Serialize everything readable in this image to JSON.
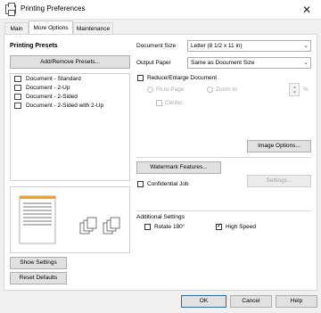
{
  "window": {
    "title": "Printing Preferences",
    "close_icon": "close-icon"
  },
  "tabs": [
    {
      "label": "Main",
      "active": false
    },
    {
      "label": "More Options",
      "active": true
    },
    {
      "label": "Maintenance",
      "active": false
    }
  ],
  "presets": {
    "title": "Printing Presets",
    "add_remove_label": "Add/Remove Presets...",
    "items": [
      {
        "label": "Document - Standard",
        "icon": "document-icon"
      },
      {
        "label": "Document - 2-Up",
        "icon": "two-up-icon"
      },
      {
        "label": "Document - 2-Sided",
        "icon": "two-sided-icon"
      },
      {
        "label": "Document - 2-Sided with 2-Up",
        "icon": "two-sided-two-up-icon"
      }
    ]
  },
  "left_buttons": {
    "show_settings": "Show Settings",
    "reset_defaults": "Reset Defaults"
  },
  "document_size": {
    "label": "Document Size",
    "value": "Letter (8 1/2 x 11 in)"
  },
  "output_paper": {
    "label": "Output Paper",
    "value": "Same as Document Size"
  },
  "reduce_enlarge": {
    "label": "Reduce/Enlarge Document",
    "fit_to_page": "Fit to Page",
    "zoom_to": "Zoom to",
    "percent": "%",
    "center": "Center"
  },
  "image_options_label": "Image Options...",
  "watermark_label": "Watermark Features...",
  "confidential_label": "Confidential Job",
  "settings_label": "Settings...",
  "additional": {
    "title": "Additional Settings",
    "rotate_label": "Rotate 180°",
    "rotate_checked": false,
    "high_speed_label": "High Speed",
    "high_speed_checked": true
  },
  "footer": {
    "ok": "OK",
    "cancel": "Cancel",
    "help": "Help"
  }
}
